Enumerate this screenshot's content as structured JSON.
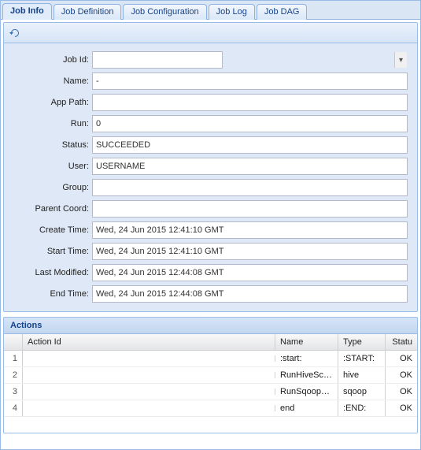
{
  "tabs": [
    {
      "label": "Job Info",
      "active": true
    },
    {
      "label": "Job Definition",
      "active": false
    },
    {
      "label": "Job Configuration",
      "active": false
    },
    {
      "label": "Job Log",
      "active": false
    },
    {
      "label": "Job DAG",
      "active": false
    }
  ],
  "form": {
    "job_id": {
      "label": "Job Id:",
      "value": ""
    },
    "name": {
      "label": "Name:",
      "value": "-"
    },
    "app_path": {
      "label": "App Path:",
      "value": ""
    },
    "run": {
      "label": "Run:",
      "value": "0"
    },
    "status": {
      "label": "Status:",
      "value": "SUCCEEDED"
    },
    "user": {
      "label": "User:",
      "value": "USERNAME"
    },
    "group": {
      "label": "Group:",
      "value": ""
    },
    "parent_coord": {
      "label": "Parent Coord:",
      "value": ""
    },
    "create_time": {
      "label": "Create Time:",
      "value": "Wed, 24 Jun 2015 12:41:10 GMT"
    },
    "start_time": {
      "label": "Start Time:",
      "value": "Wed, 24 Jun 2015 12:41:10 GMT"
    },
    "last_modified": {
      "label": "Last Modified:",
      "value": "Wed, 24 Jun 2015 12:44:08 GMT"
    },
    "end_time": {
      "label": "End Time:",
      "value": "Wed, 24 Jun 2015 12:44:08 GMT"
    }
  },
  "actions": {
    "title": "Actions",
    "columns": {
      "action_id": "Action Id",
      "name": "Name",
      "type": "Type",
      "status": "Statu"
    },
    "rows": [
      {
        "n": "1",
        "action_id": "",
        "name": ":start:",
        "type": ":START:",
        "status": "OK"
      },
      {
        "n": "2",
        "action_id": "",
        "name": "RunHiveScript",
        "type": "hive",
        "status": "OK"
      },
      {
        "n": "3",
        "action_id": "",
        "name": "RunSqoopE...",
        "type": "sqoop",
        "status": "OK"
      },
      {
        "n": "4",
        "action_id": "",
        "name": "end",
        "type": ":END:",
        "status": "OK"
      }
    ]
  }
}
